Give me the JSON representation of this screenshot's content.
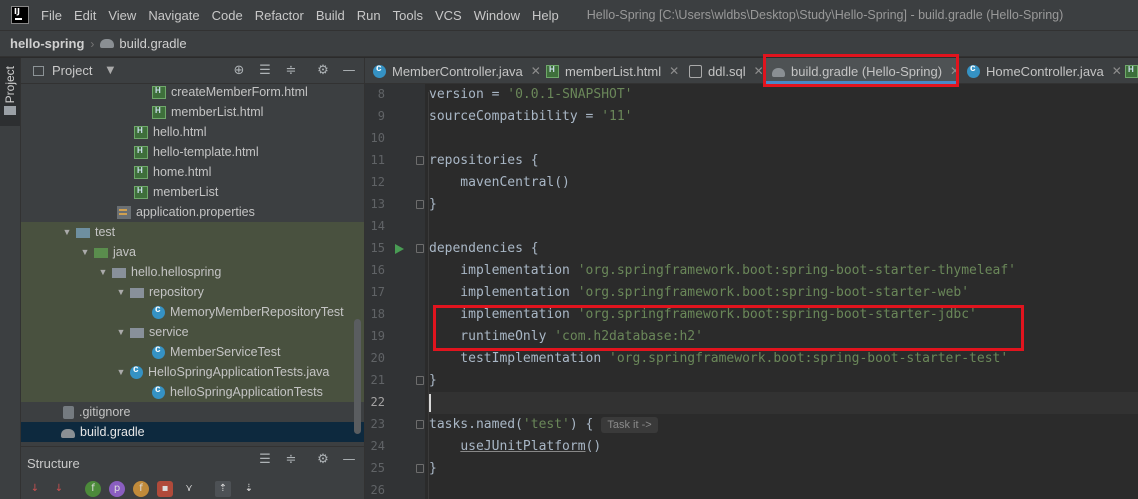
{
  "menubar": {
    "items": [
      "File",
      "Edit",
      "View",
      "Navigate",
      "Code",
      "Refactor",
      "Build",
      "Run",
      "Tools",
      "VCS",
      "Window",
      "Help"
    ],
    "window_title": "Hello-Spring [C:\\Users\\wldbs\\Desktop\\Study\\Hello-Spring] - build.gradle (Hello-Spring)"
  },
  "navbar": {
    "root": "hello-spring",
    "file": "build.gradle"
  },
  "left_strip": {
    "project_label": "Project"
  },
  "project_panel": {
    "title": "Project",
    "tree": [
      {
        "label": "createMemberForm.html",
        "icon": "html"
      },
      {
        "label": "memberList.html",
        "icon": "html"
      },
      {
        "label": "hello.html",
        "icon": "html"
      },
      {
        "label": "hello-template.html",
        "icon": "html"
      },
      {
        "label": "home.html",
        "icon": "html"
      },
      {
        "label": "memberList",
        "icon": "html"
      },
      {
        "label": "application.properties",
        "icon": "props"
      },
      {
        "label": "test",
        "icon": "folder"
      },
      {
        "label": "java",
        "icon": "folder-green"
      },
      {
        "label": "hello.hellospring",
        "icon": "folder"
      },
      {
        "label": "repository",
        "icon": "folder"
      },
      {
        "label": "MemoryMemberRepositoryTest",
        "icon": "class"
      },
      {
        "label": "service",
        "icon": "folder"
      },
      {
        "label": "MemberServiceTest",
        "icon": "class"
      },
      {
        "label": "HelloSpringApplicationTests.java",
        "icon": "class"
      },
      {
        "label": "helloSpringApplicationTests",
        "icon": "class"
      },
      {
        "label": ".gitignore",
        "icon": "git"
      },
      {
        "label": "build.gradle",
        "icon": "gradle"
      }
    ]
  },
  "structure_panel": {
    "title": "Structure"
  },
  "editor": {
    "tabs": [
      {
        "label": "MemberController.java",
        "icon": "class-icon"
      },
      {
        "label": "memberList.html",
        "icon": "html-icon"
      },
      {
        "label": "ddl.sql",
        "icon": "sql-icon"
      },
      {
        "label": "build.gradle (Hello-Spring)",
        "icon": "gradle-icon",
        "active": true
      },
      {
        "label": "HomeController.java",
        "icon": "class-icon"
      }
    ],
    "line_numbers": [
      "8",
      "9",
      "10",
      "11",
      "12",
      "13",
      "14",
      "15",
      "16",
      "17",
      "18",
      "19",
      "20",
      "21",
      "22",
      "23",
      "24",
      "25",
      "26"
    ],
    "code": {
      "l8_a": "version = ",
      "l8_b": "'0.0.1-SNAPSHOT'",
      "l9_a": "sourceCompatibility = ",
      "l9_b": "'11'",
      "l11": "repositories {",
      "l12": "    mavenCentral()",
      "l13": "}",
      "l15": "dependencies {",
      "l16_a": "    implementation ",
      "l16_b": "'org.springframework.boot:spring-boot-starter-thymeleaf'",
      "l17_a": "    implementation ",
      "l17_b": "'org.springframework.boot:spring-boot-starter-web'",
      "l18_a": "    implementation ",
      "l18_b": "'org.springframework.boot:spring-boot-starter-jdbc'",
      "l19_a": "    runtimeOnly ",
      "l19_b": "'com.h2database:h2'",
      "l20_a": "    testImplementation ",
      "l20_b": "'org.springframework.boot:spring-boot-starter-test'",
      "l21": "}",
      "l23_a": "tasks.named(",
      "l23_b": "'test'",
      "l23_c": ") {",
      "l23_hint": "Task it ->",
      "l24_a": "    ",
      "l24_b": "useJUnitPlatform",
      "l24_c": "()",
      "l25": "}"
    }
  },
  "colors": {
    "highlight": "#e1141e",
    "string": "#6a8759",
    "keyword": "#9876aa",
    "active_tab_underline": "#4a88c7"
  }
}
